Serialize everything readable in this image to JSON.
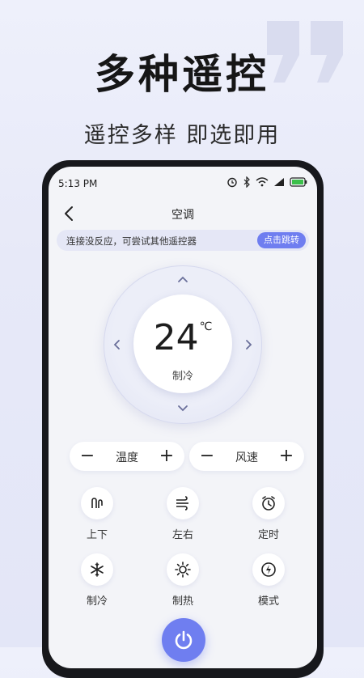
{
  "promo": {
    "title": "多种遥控",
    "subtitle": "遥控多样 即选即用"
  },
  "status_bar": {
    "time": "5:13 PM",
    "icons": [
      "alarm-icon",
      "bluetooth-icon",
      "wifi-icon",
      "signal-icon",
      "battery-icon"
    ]
  },
  "nav": {
    "title": "空调",
    "back_icon": "back-icon"
  },
  "hint": {
    "text": "连接没反应，可尝试其他遥控器",
    "button": "点击跳转"
  },
  "dial": {
    "temperature": "24",
    "unit": "℃",
    "mode": "制冷",
    "arrows": [
      "up-arrow-icon",
      "down-arrow-icon",
      "left-arrow-icon",
      "right-arrow-icon"
    ]
  },
  "controls": {
    "temperature": {
      "label": "温度",
      "minus": "−",
      "plus": "+"
    },
    "fan_speed": {
      "label": "风速",
      "minus": "−",
      "plus": "+"
    }
  },
  "functions": [
    {
      "label": "上下",
      "icon": "swing-vertical-icon"
    },
    {
      "label": "左右",
      "icon": "swing-horizontal-icon"
    },
    {
      "label": "定时",
      "icon": "timer-icon"
    },
    {
      "label": "制冷",
      "icon": "snowflake-icon"
    },
    {
      "label": "制热",
      "icon": "sun-icon"
    },
    {
      "label": "模式",
      "icon": "mode-icon"
    }
  ],
  "colors": {
    "accent": "#6f7ef0",
    "background": "#eef0fb"
  }
}
